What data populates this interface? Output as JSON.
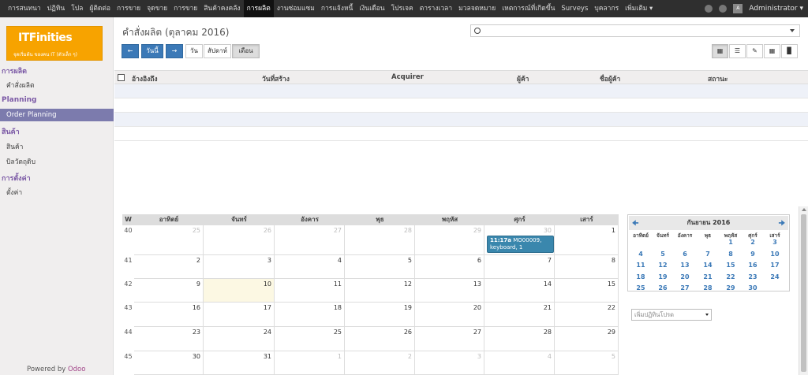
{
  "topbar": {
    "menu": [
      "การสนทนา",
      "ปฏิทิน",
      "โปล",
      "ผู้ติดต่อ",
      "การขาย",
      "จุดขาย",
      "การขาย",
      "สินค้าคงคลัง",
      "การผลิต",
      "งานซ่อมแซม",
      "การแจ้งหนี้",
      "เงินเดือน",
      "โปรเจค",
      "ตารางเวลา",
      "มวลจดหมาย",
      "เหตการณ์ที่เกิดขึ้น",
      "Surveys",
      "บุคลากร",
      "เพิ่มเติม ▾"
    ],
    "active_index": 8,
    "user": "Administrator ▾"
  },
  "logo": {
    "name": "ITFinities",
    "tagline": "จุดเริ่มต้น ของคน IT (ตัวเล็ก ๆ)"
  },
  "sidebar": {
    "sections": [
      {
        "label": "การผลิต",
        "items": [
          "คำสั่งผลิต"
        ]
      },
      {
        "label": "Planning",
        "items": [
          "Order Planning"
        ]
      },
      {
        "label": "สินค้า",
        "items": [
          "สินค้า",
          "บิลวัตถุดิบ"
        ]
      },
      {
        "label": "การตั้งค่า",
        "items": [
          "ตั้งค่า"
        ]
      }
    ],
    "active_item": "Order Planning",
    "powered_prefix": "Powered by",
    "powered_brand": "Odoo"
  },
  "main": {
    "title": "คำสั่งผลิต (ตุลาคม 2016)",
    "search_placeholder": "",
    "nav": {
      "today": "วันนี้",
      "day": "วัน",
      "week": "สัปดาห์",
      "month": "เดือน"
    },
    "list_columns": [
      "อ้างอิงถึง",
      "วันที่สร้าง",
      "Acquirer",
      "ผู้ค้า",
      "ชื่อผู้ค้า",
      "สถานะ"
    ]
  },
  "calendar": {
    "headers": [
      "W",
      "อาทิตย์",
      "จันทร์",
      "อังคาร",
      "พุธ",
      "พฤหัส",
      "ศุกร์",
      "เสาร์"
    ],
    "weeks": [
      {
        "num": "40",
        "days": [
          "25",
          "26",
          "27",
          "28",
          "29",
          "30",
          "1"
        ],
        "other": [
          true,
          true,
          true,
          true,
          true,
          true,
          false
        ]
      },
      {
        "num": "41",
        "days": [
          "2",
          "3",
          "4",
          "5",
          "6",
          "7",
          "8"
        ],
        "other": [
          false,
          false,
          false,
          false,
          false,
          false,
          false
        ]
      },
      {
        "num": "42",
        "days": [
          "9",
          "10",
          "11",
          "12",
          "13",
          "14",
          "15"
        ],
        "other": [
          false,
          false,
          false,
          false,
          false,
          false,
          false
        ]
      },
      {
        "num": "43",
        "days": [
          "16",
          "17",
          "18",
          "19",
          "20",
          "21",
          "22"
        ],
        "other": [
          false,
          false,
          false,
          false,
          false,
          false,
          false
        ]
      },
      {
        "num": "44",
        "days": [
          "23",
          "24",
          "25",
          "26",
          "27",
          "28",
          "29"
        ],
        "other": [
          false,
          false,
          false,
          false,
          false,
          false,
          false
        ]
      },
      {
        "num": "45",
        "days": [
          "30",
          "31",
          "1",
          "2",
          "3",
          "4",
          "5"
        ],
        "other": [
          false,
          false,
          true,
          true,
          true,
          true,
          true
        ]
      }
    ],
    "today_week": 2,
    "today_day": 1,
    "event": {
      "time": "11:17a",
      "title": "MO00009,",
      "detail": "keyboard, 1"
    }
  },
  "mini_calendar": {
    "month": "กันยายน 2016",
    "dow": [
      "อาทิตย์",
      "จันทร์",
      "อังคาร",
      "พุธ",
      "พฤหัส",
      "ศุกร์",
      "เสาร์"
    ],
    "rows": [
      [
        "",
        "",
        "",
        "",
        "1",
        "2",
        "3"
      ],
      [
        "4",
        "5",
        "6",
        "7",
        "8",
        "9",
        "10"
      ],
      [
        "11",
        "12",
        "13",
        "14",
        "15",
        "16",
        "17"
      ],
      [
        "18",
        "19",
        "20",
        "21",
        "22",
        "23",
        "24"
      ],
      [
        "25",
        "26",
        "27",
        "28",
        "29",
        "30",
        ""
      ]
    ]
  },
  "filter_select": {
    "placeholder": "เพิ่มปฏิทินโปรด"
  }
}
